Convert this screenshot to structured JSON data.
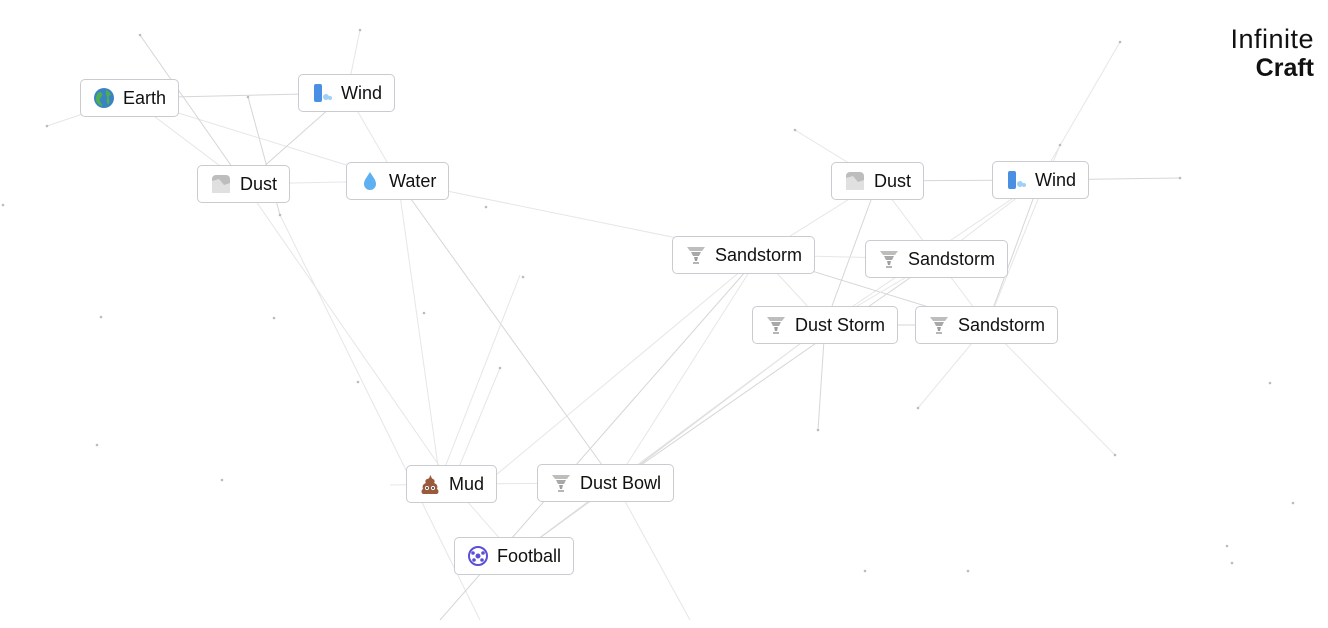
{
  "logo": {
    "line1": "Infinite",
    "line2": "Craft"
  },
  "items": [
    {
      "id": "earth",
      "label": "Earth",
      "icon": "earth-globe-icon"
    },
    {
      "id": "wind1",
      "label": "Wind",
      "icon": "wind-face-icon"
    },
    {
      "id": "dust1",
      "label": "Dust",
      "icon": "dust-cloud-icon"
    },
    {
      "id": "water",
      "label": "Water",
      "icon": "water-drop-icon"
    },
    {
      "id": "dust2",
      "label": "Dust",
      "icon": "dust-cloud-icon"
    },
    {
      "id": "wind2",
      "label": "Wind",
      "icon": "wind-face-icon"
    },
    {
      "id": "sand1",
      "label": "Sandstorm",
      "icon": "tornado-icon"
    },
    {
      "id": "sand2",
      "label": "Sandstorm",
      "icon": "tornado-icon"
    },
    {
      "id": "duststorm",
      "label": "Dust Storm",
      "icon": "tornado-icon"
    },
    {
      "id": "sand3",
      "label": "Sandstorm",
      "icon": "tornado-icon"
    },
    {
      "id": "mud",
      "label": "Mud",
      "icon": "poop-icon"
    },
    {
      "id": "dustbowl",
      "label": "Dust Bowl",
      "icon": "tornado-icon"
    },
    {
      "id": "football",
      "label": "Football",
      "icon": "soccer-ball-icon"
    }
  ]
}
